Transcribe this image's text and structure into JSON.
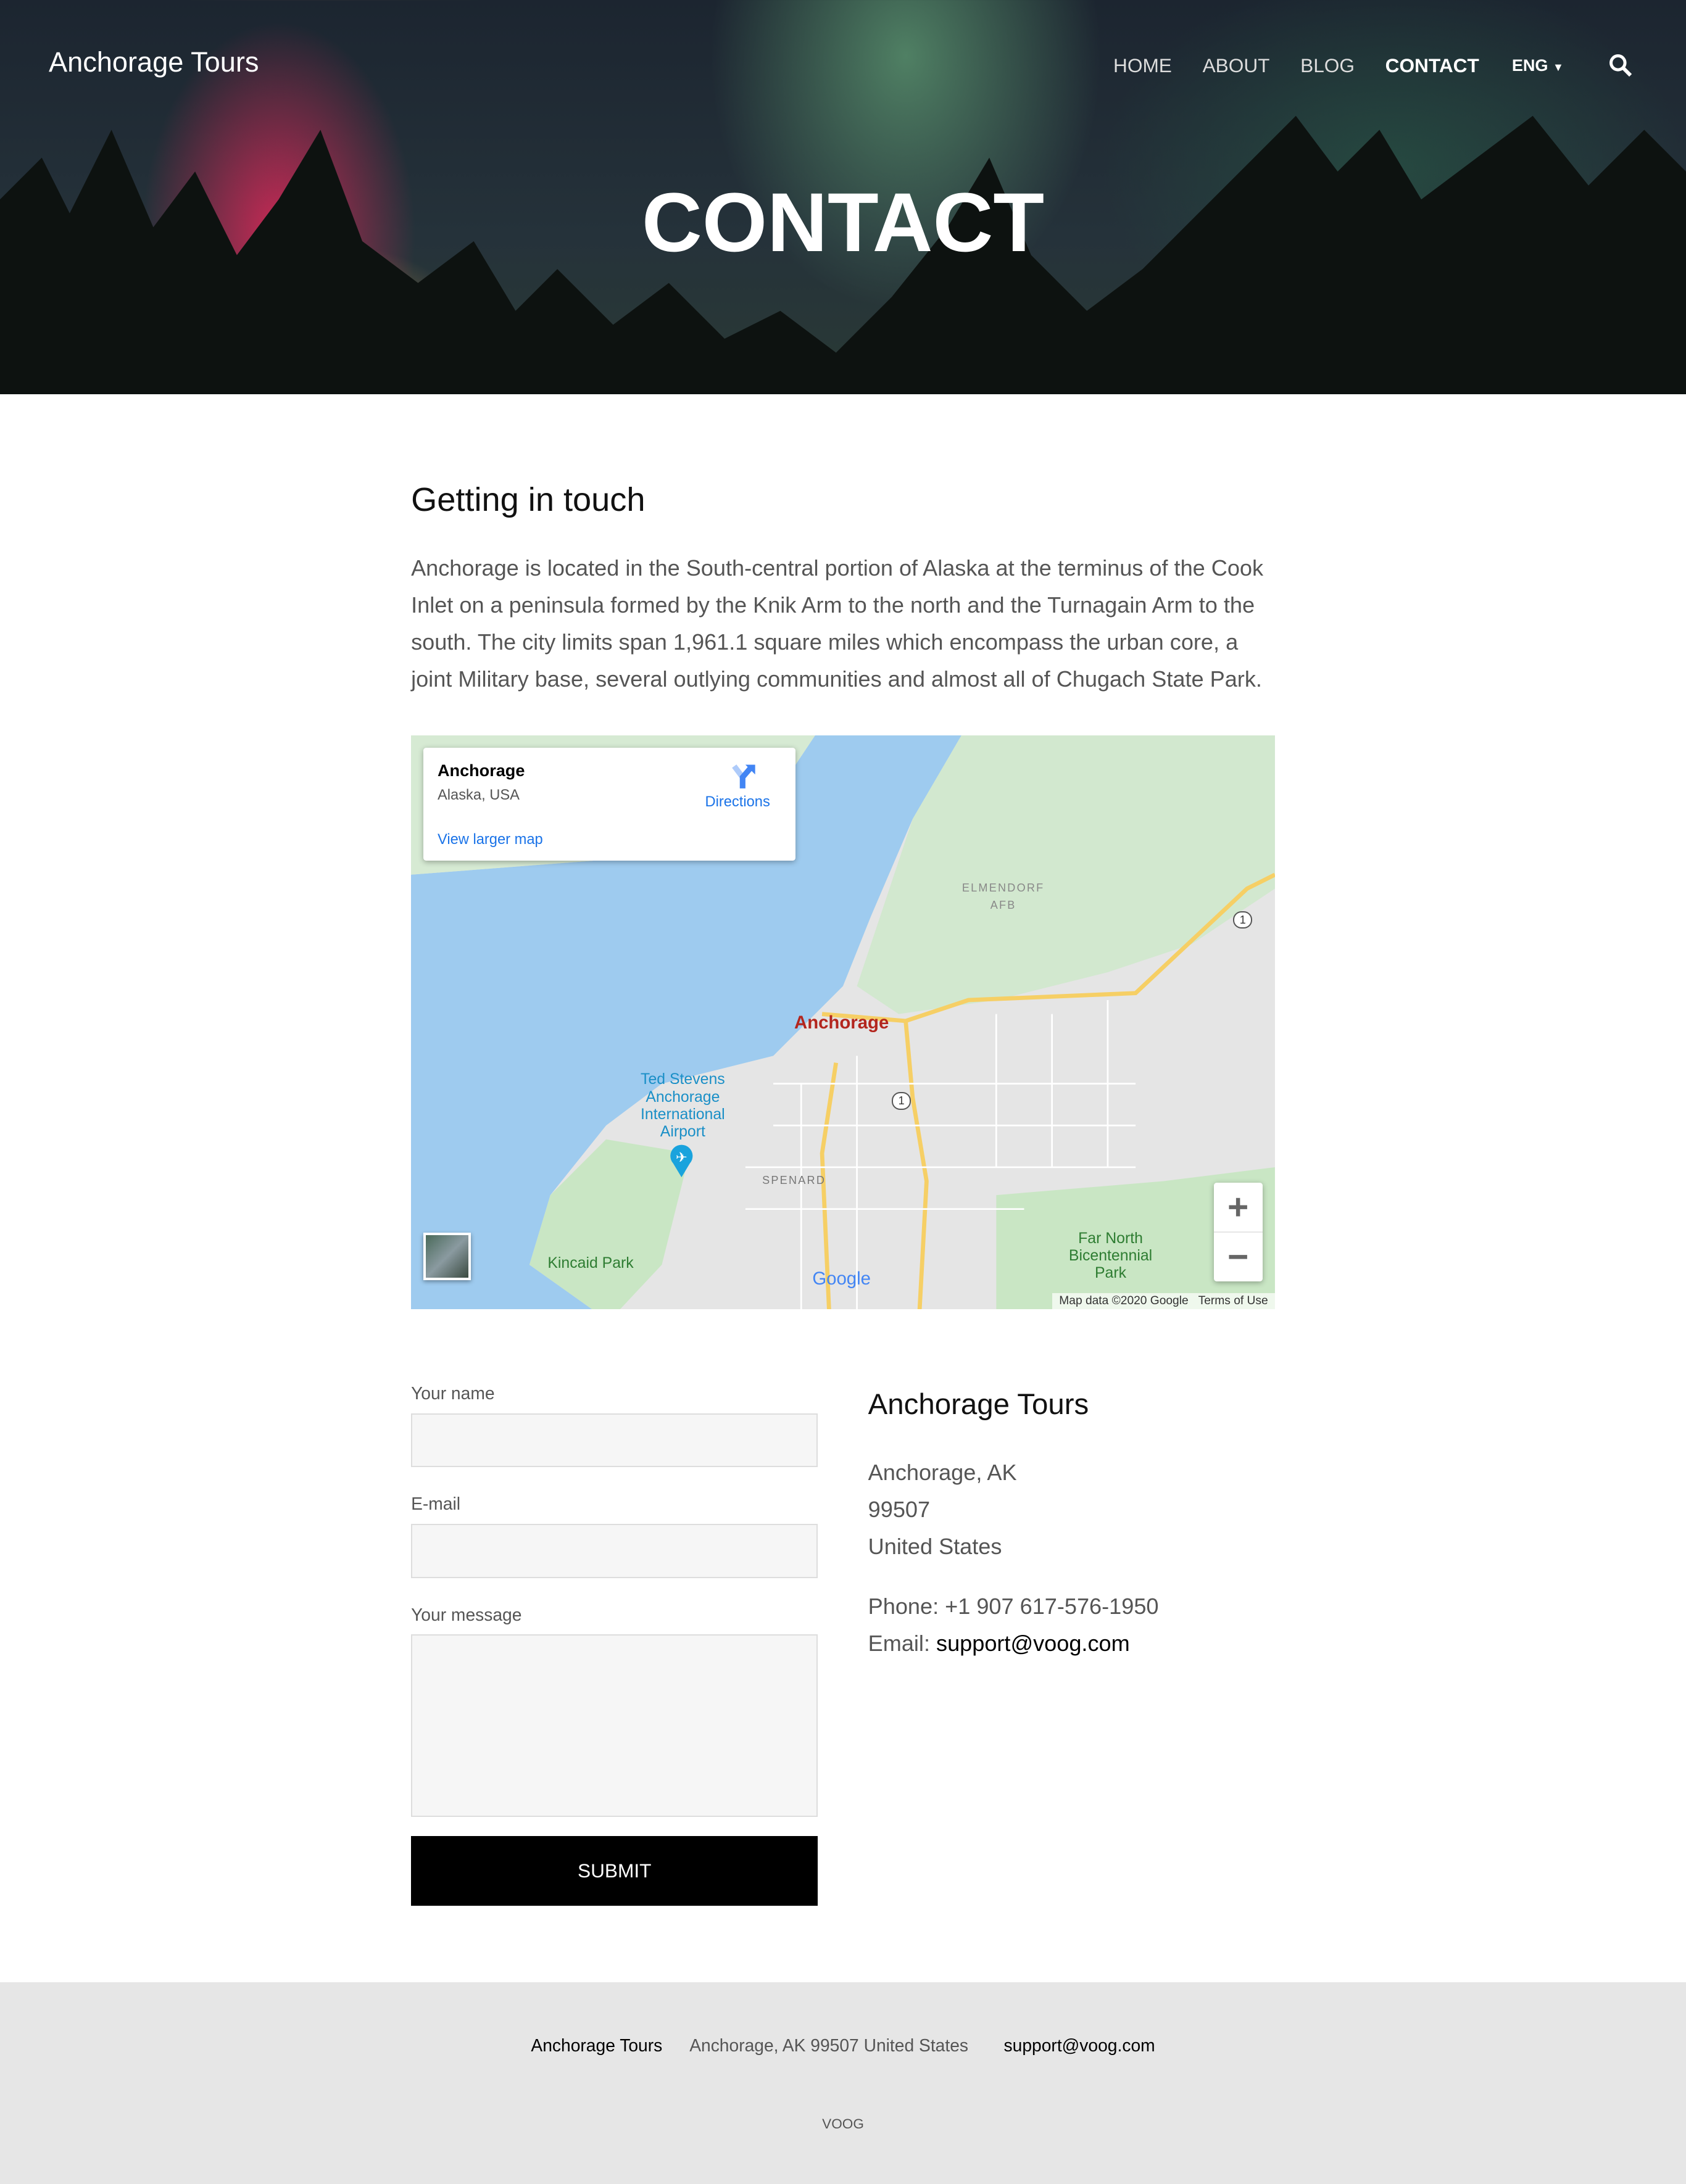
{
  "header": {
    "brand": "Anchorage Tours",
    "nav": [
      "HOME",
      "ABOUT",
      "BLOG",
      "CONTACT"
    ],
    "active": "CONTACT",
    "language": "ENG",
    "search_icon": "search-icon",
    "hero_title": "CONTACT"
  },
  "main": {
    "heading": "Getting in touch",
    "intro": "Anchorage is located in the South-central portion of Alaska at the terminus of the Cook Inlet on a peninsula formed by the Knik Arm to the north and the Turnagain Arm to the south. The city limits span 1,961.1 square miles which encompass the urban core, a joint Military base, several outlying communities and almost all of Chugach State Park.",
    "map": {
      "place": "Anchorage",
      "region": "Alaska, USA",
      "directions": "Directions",
      "view_larger": "View larger map",
      "labels": {
        "city": "Anchorage",
        "airport": "Ted Stevens Anchorage International Airport",
        "elmendorf": "ELMENDORF AFB",
        "spenard": "SPENARD",
        "kincaid": "Kincaid Park",
        "farnorth": "Far North Bicentennial Park",
        "route": "1",
        "google": "Google"
      },
      "zoom_in": "+",
      "zoom_out": "−",
      "attribution": "Map data ©2020 Google",
      "terms": "Terms of Use"
    },
    "form": {
      "name_label": "Your name",
      "email_label": "E-mail",
      "message_label": "Your message",
      "name_value": "",
      "email_value": "",
      "message_value": "",
      "submit": "SUBMIT"
    },
    "contact": {
      "title": "Anchorage Tours",
      "city": "Anchorage, AK",
      "zip": "99507",
      "country": "United States",
      "phone": "Phone: +1 907 617-576-1950",
      "email_label": "Email: ",
      "email": "support@voog.com"
    }
  },
  "footer": {
    "name": "Anchorage Tours",
    "address": "Anchorage, AK 99507 United States",
    "email": "support@voog.com",
    "logo": "VOOG"
  },
  "colors": {
    "accent": "#000000",
    "link": "#1a73e8",
    "footer_bg": "#e6e6e6"
  }
}
